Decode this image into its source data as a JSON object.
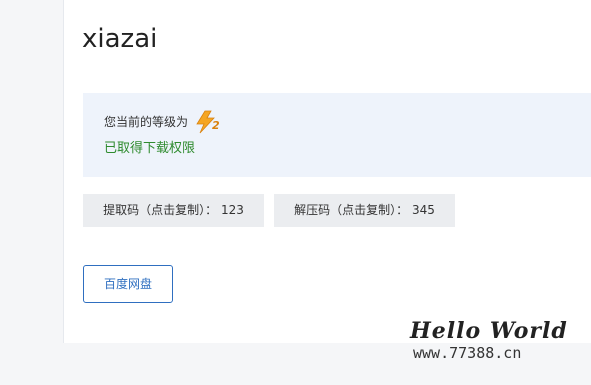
{
  "page": {
    "title": "xiazai"
  },
  "info": {
    "level_text": "您当前的等级为",
    "badge_level": "2",
    "access_text": "已取得下载权限"
  },
  "codes": {
    "extract": "提取码（点击复制）： 123",
    "unzip": "解压码（点击复制）： 345"
  },
  "buttons": {
    "baidu_pan": "百度网盘"
  },
  "watermark": {
    "title": "Hello World",
    "url": "www.77388.cn"
  },
  "colors": {
    "panel_bg": "#eef3fb",
    "access_green": "#2e8b2e",
    "button_blue": "#2f6fc0"
  }
}
